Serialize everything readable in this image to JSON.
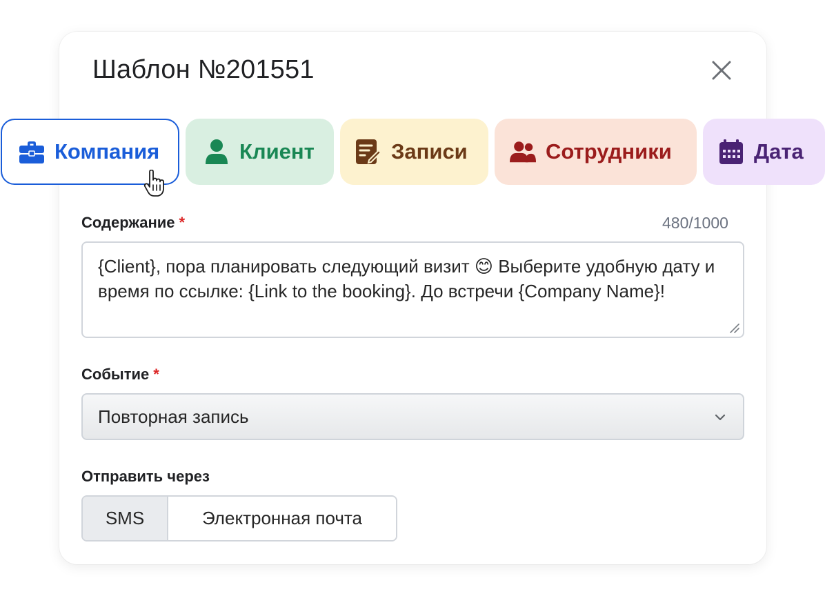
{
  "modal": {
    "title": "Шаблон №201551"
  },
  "tabs": [
    {
      "label": "Компания",
      "icon": "briefcase-icon",
      "color": "#1a5dd9"
    },
    {
      "label": "Клиент",
      "icon": "user-icon",
      "color": "#198754"
    },
    {
      "label": "Записи",
      "icon": "edit-note-icon",
      "color": "#6b3a17"
    },
    {
      "label": "Сотрудники",
      "icon": "users-icon",
      "color": "#9b1c1c"
    },
    {
      "label": "Дата",
      "icon": "calendar-icon",
      "color": "#4a2374"
    }
  ],
  "content": {
    "label": "Содержание",
    "required_mark": "*",
    "counter": "480/1000",
    "value": "{Client}, пора планировать следующий визит 😊 Выберите удобную дату и время по ссылке: {Link to the booking}. До встречи {Company Name}!"
  },
  "event": {
    "label": "Событие",
    "required_mark": "*",
    "selected": "Повторная запись"
  },
  "send_via": {
    "label": "Отправить через",
    "options": [
      {
        "label": "SMS",
        "selected": true
      },
      {
        "label": "Электронная почта",
        "selected": false
      }
    ]
  }
}
